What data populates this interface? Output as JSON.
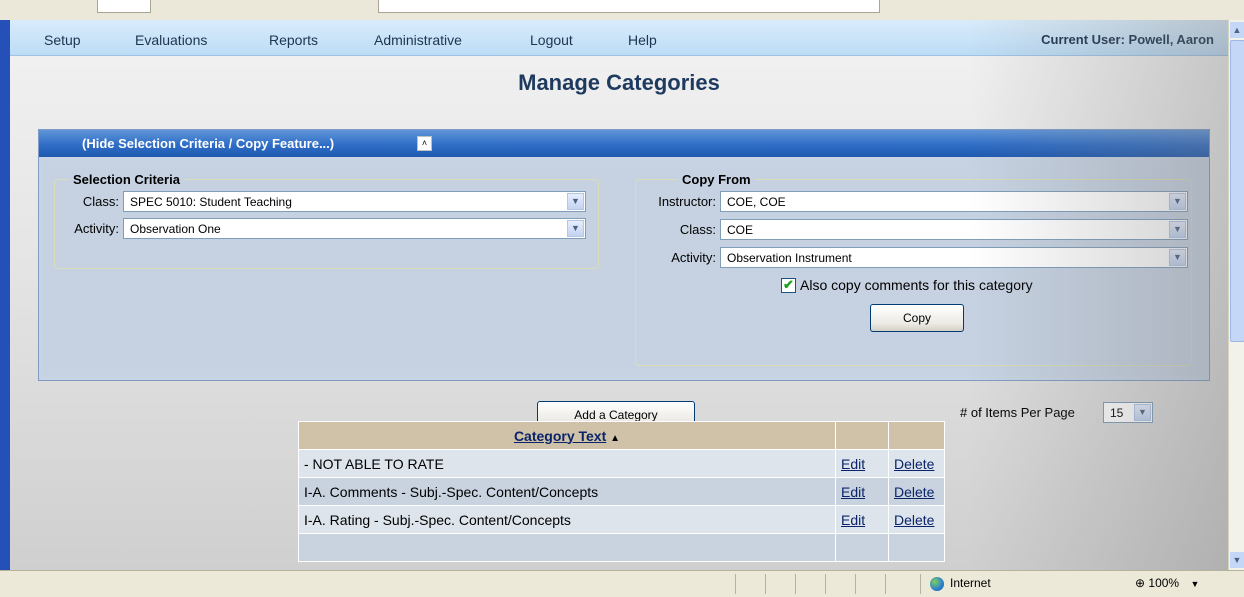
{
  "menu": {
    "items": [
      "Setup",
      "Evaluations",
      "Reports",
      "Administrative",
      "Logout",
      "Help"
    ],
    "current_user": "Current User: Powell, Aaron"
  },
  "page": {
    "title": "Manage Categories"
  },
  "panel": {
    "toggle_label": "(Hide Selection Criteria / Copy Feature...)"
  },
  "selection": {
    "legend": "Selection Criteria",
    "class_label": "Class:",
    "class_value": "SPEC 5010: Student Teaching",
    "activity_label": "Activity:",
    "activity_value": "Observation One"
  },
  "copy_from": {
    "legend": "Copy From",
    "instructor_label": "Instructor:",
    "instructor_value": "COE, COE",
    "class_label": "Class:",
    "class_value": "COE",
    "activity_label": "Activity:",
    "activity_value": "Observation Instrument",
    "also_copy_label": "Also copy comments for this category",
    "also_copy_checked": true,
    "copy_button": "Copy"
  },
  "actions": {
    "add_category": "Add a Category"
  },
  "paging": {
    "items_per_page_label": "# of Items Per Page",
    "items_per_page_value": "15"
  },
  "table": {
    "header": "Category Text",
    "sort_indicator": "▲",
    "rows": [
      {
        "text": "- NOT ABLE TO RATE",
        "edit": "Edit",
        "delete": "Delete"
      },
      {
        "text": "I-A. Comments - Subj.-Spec. Content/Concepts",
        "edit": "Edit",
        "delete": "Delete"
      },
      {
        "text": "I-A. Rating - Subj.-Spec. Content/Concepts",
        "edit": "Edit",
        "delete": "Delete"
      }
    ]
  },
  "statusbar": {
    "zone": "Internet",
    "zoom": "100%"
  }
}
